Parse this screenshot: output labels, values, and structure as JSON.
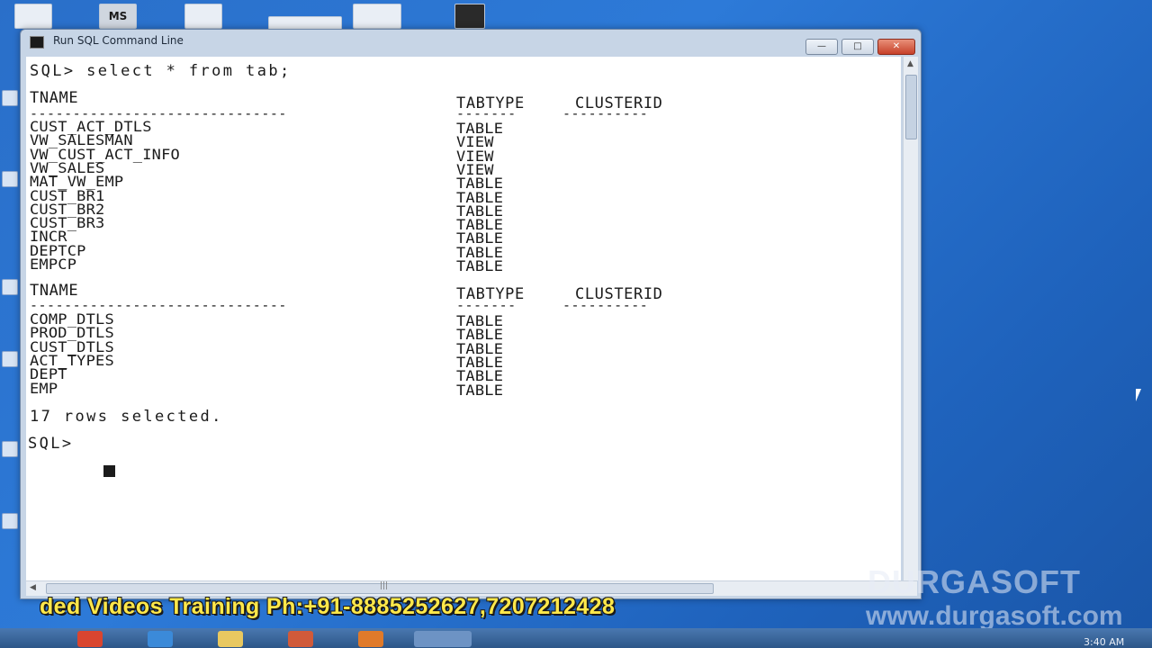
{
  "window": {
    "title": "Run SQL Command Line",
    "minimize_label": "—",
    "maximize_label": "□",
    "close_label": "✕"
  },
  "console": {
    "command": "SQL> select * from tab;",
    "header_name": "TNAME",
    "header_type": "TABTYPE",
    "header_cluster": "CLUSTERID",
    "dash_name": "------------------------------",
    "dash_type": "-------",
    "dash_cluster": "----------",
    "block1": [
      {
        "name": "CUST_ACT_DTLS",
        "type": "TABLE"
      },
      {
        "name": "VW_SALESMAN",
        "type": "VIEW"
      },
      {
        "name": "VW_CUST_ACT_INFO",
        "type": "VIEW"
      },
      {
        "name": "VW_SALES",
        "type": "VIEW"
      },
      {
        "name": "MAT_VW_EMP",
        "type": "TABLE"
      },
      {
        "name": "CUST_BR1",
        "type": "TABLE"
      },
      {
        "name": "CUST_BR2",
        "type": "TABLE"
      },
      {
        "name": "CUST_BR3",
        "type": "TABLE"
      },
      {
        "name": "INCR",
        "type": "TABLE"
      },
      {
        "name": "DEPTCP",
        "type": "TABLE"
      },
      {
        "name": "EMPCP",
        "type": "TABLE"
      }
    ],
    "block2": [
      {
        "name": "COMP_DTLS",
        "type": "TABLE"
      },
      {
        "name": "PROD_DTLS",
        "type": "TABLE"
      },
      {
        "name": "CUST_DTLS",
        "type": "TABLE"
      },
      {
        "name": "ACT_TYPES",
        "type": "TABLE"
      },
      {
        "name": "DEPT",
        "type": "TABLE"
      },
      {
        "name": "EMP",
        "type": "TABLE"
      }
    ],
    "summary": "17 rows selected.",
    "prompt": "SQL>"
  },
  "desktop": {
    "top_icon_label": "MS"
  },
  "overlay": {
    "banner": "ded Videos Training Ph:+91-8885252627,7207212428",
    "brand": "DURGASOFT",
    "site": "www.durgasoft.com"
  },
  "taskbar": {
    "clock": "3:40 AM"
  }
}
